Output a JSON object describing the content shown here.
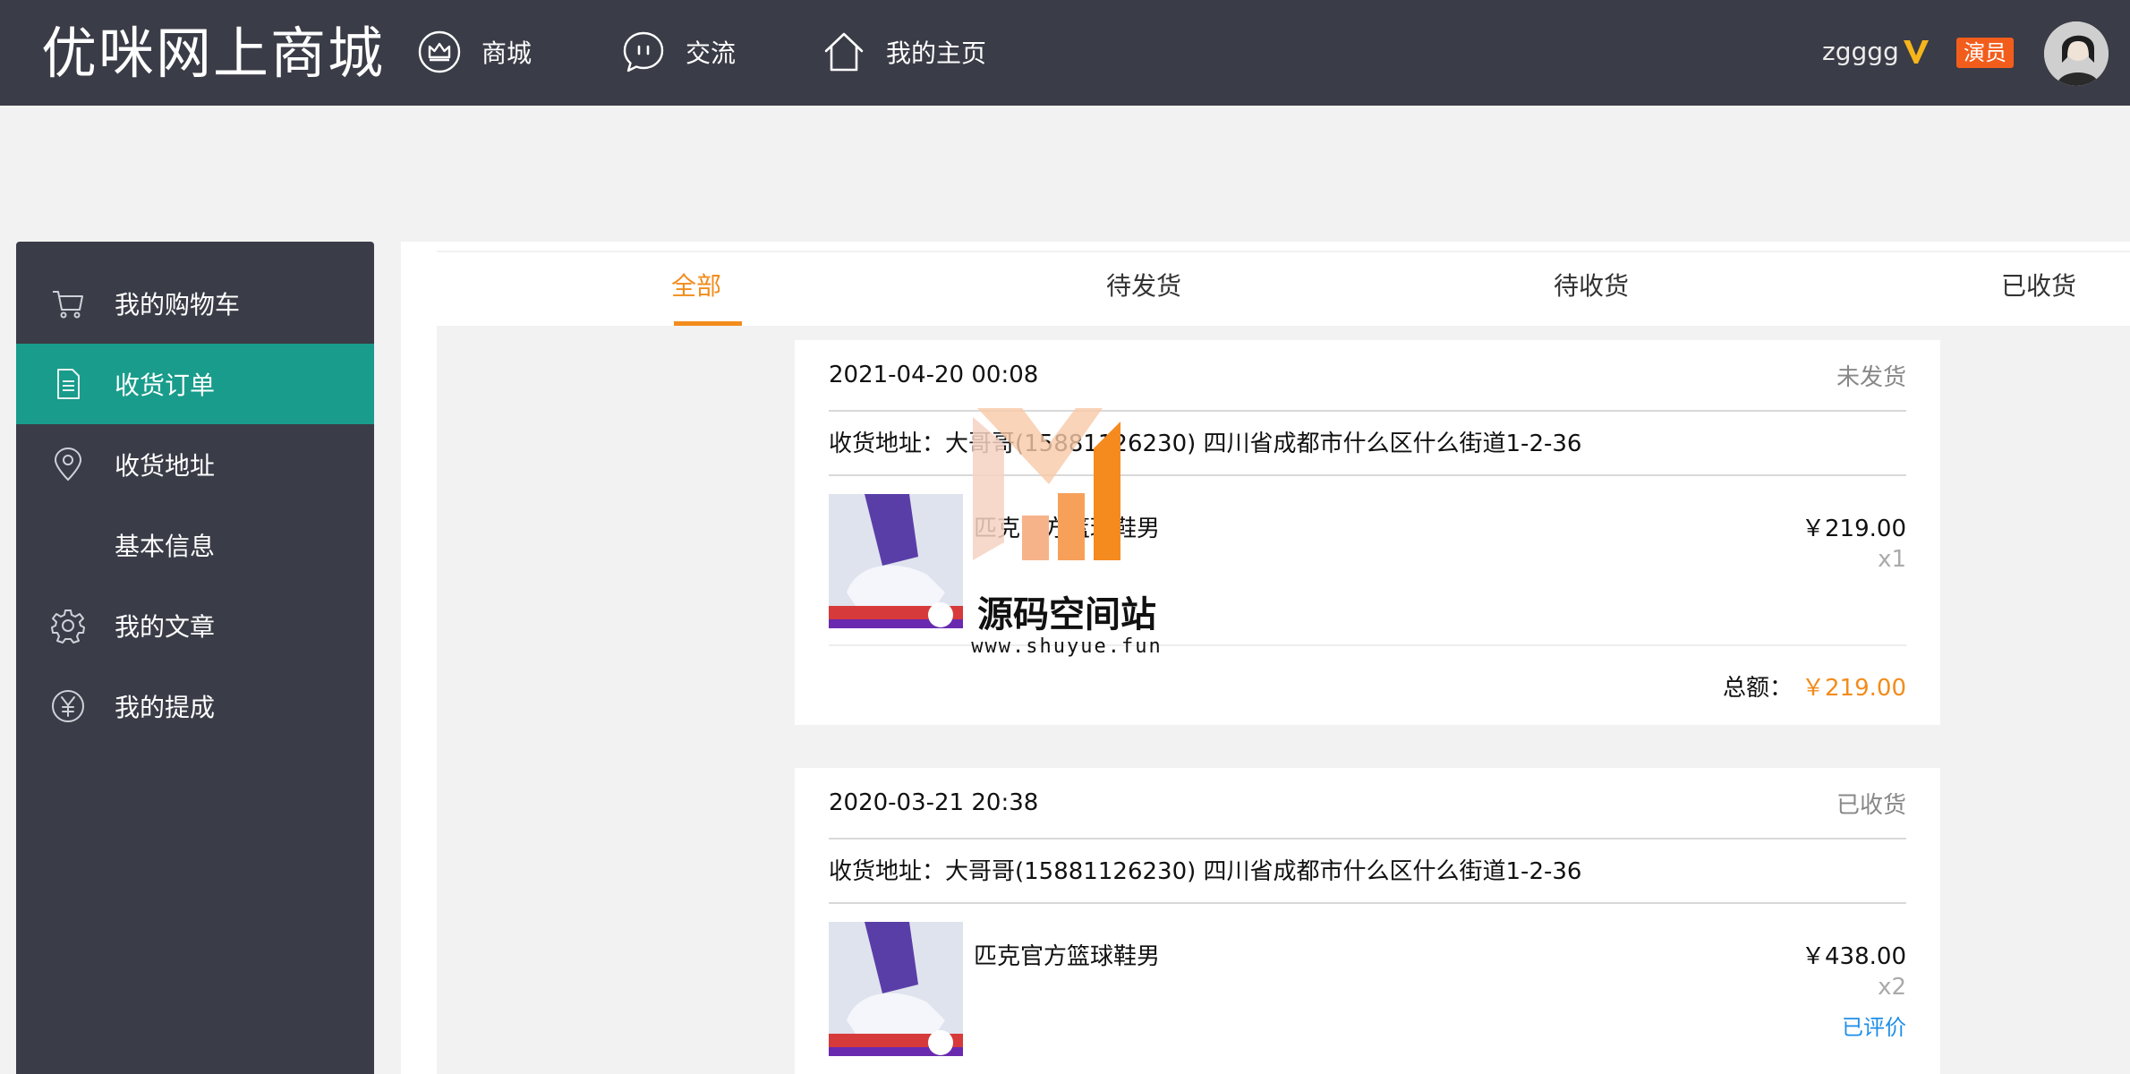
{
  "header": {
    "brand": "优咪网上商城",
    "nav": [
      {
        "label": "商城",
        "icon": "crown-icon"
      },
      {
        "label": "交流",
        "icon": "chat-bubble-icon"
      },
      {
        "label": "我的主页",
        "icon": "home-icon"
      }
    ],
    "user": {
      "name": "zgggg",
      "vip_icon": "vip-v-icon",
      "role_badge": "演员"
    },
    "colors": {
      "bar": "#3a3c47",
      "vip": "#f5b51b",
      "badge": "#f25d1c"
    }
  },
  "sidebar": {
    "items": [
      {
        "label": "我的购物车",
        "icon": "cart-icon",
        "active": false
      },
      {
        "label": "收货订单",
        "icon": "document-icon",
        "active": true
      },
      {
        "label": "收货地址",
        "icon": "location-pin-icon",
        "active": false
      },
      {
        "label": "基本信息",
        "icon": "",
        "active": false
      },
      {
        "label": "我的文章",
        "icon": "gear-icon",
        "active": false
      },
      {
        "label": "我的提成",
        "icon": "yen-circle-icon",
        "active": false
      }
    ],
    "colors": {
      "background": "#3a3c47",
      "active": "#199c8b"
    }
  },
  "tabs": [
    {
      "label": "全部",
      "active": true
    },
    {
      "label": "待发货",
      "active": false
    },
    {
      "label": "待收货",
      "active": false
    },
    {
      "label": "已收货",
      "active": false
    }
  ],
  "accent_color": "#f28c1c",
  "orders": [
    {
      "date": "2021-04-20 00:08",
      "status": "未发货",
      "address": "收货地址：大哥哥(15881126230) 四川省成都市什么区什么街道1-2-36",
      "product": {
        "name": "匹克官方篮球鞋男",
        "price": "￥219.00",
        "qty": "x1",
        "review": ""
      },
      "total_label": "总额：",
      "total_amount": "￥219.00"
    },
    {
      "date": "2020-03-21 20:38",
      "status": "已收货",
      "address": "收货地址：大哥哥(15881126230) 四川省成都市什么区什么街道1-2-36",
      "product": {
        "name": "匹克官方篮球鞋男",
        "price": "￥438.00",
        "qty": "x2",
        "review": "已评价"
      }
    }
  ],
  "watermark": {
    "title": "源码空间站",
    "url": "www.shuyue.fun"
  }
}
